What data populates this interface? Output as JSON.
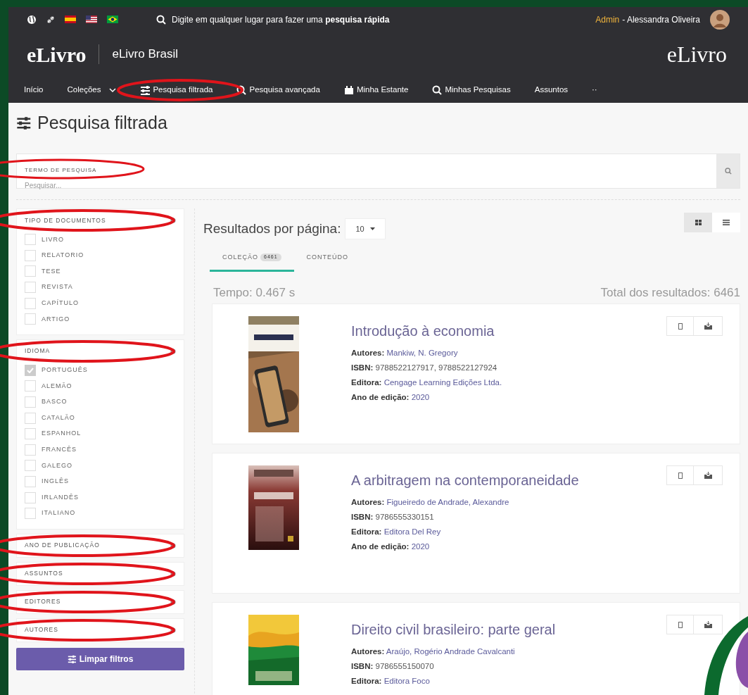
{
  "top_bar": {
    "search_hint": "Digite em qualquer lugar para fazer uma **pesquisa rápida**",
    "user_role": "Admin",
    "user_name": "- Alessandra Oliveira"
  },
  "brand": {
    "logo": "eLivro",
    "site_name": "eLivro Brasil",
    "right_logo": "eLivro"
  },
  "nav": [
    {
      "label": "Início",
      "kind": "plain",
      "highlighted": false
    },
    {
      "label": "Coleções",
      "kind": "dropdown",
      "highlighted": false
    },
    {
      "label": "Pesquisa filtrada",
      "kind": "filter",
      "highlighted": true
    },
    {
      "label": "Pesquisa avançada",
      "kind": "search",
      "highlighted": false
    },
    {
      "label": "Minha Estante",
      "kind": "shelf",
      "highlighted": false
    },
    {
      "label": "Minhas Pesquisas",
      "kind": "search",
      "highlighted": false
    },
    {
      "label": "Assuntos",
      "kind": "plain",
      "highlighted": false
    },
    {
      "label": "··",
      "kind": "plain",
      "highlighted": false
    }
  ],
  "page_title": "Pesquisa filtrada",
  "search": {
    "label": "TERMO DE PESQUISA",
    "placeholder": "Pesquisar...",
    "highlighted": true
  },
  "filters": [
    {
      "title": "TIPO DE DOCUMENTOS",
      "expanded": true,
      "highlighted": true,
      "options": [
        {
          "label": "LIVRO",
          "checked": false
        },
        {
          "label": "RELATORIO",
          "checked": false
        },
        {
          "label": "TESE",
          "checked": false
        },
        {
          "label": "REVISTA",
          "checked": false
        },
        {
          "label": "CAPÍTULO",
          "checked": false
        },
        {
          "label": "ARTIGO",
          "checked": false
        }
      ]
    },
    {
      "title": "IDIOMA",
      "expanded": true,
      "highlighted": true,
      "options": [
        {
          "label": "PORTUGUÊS",
          "checked": true
        },
        {
          "label": "ALEMÃO",
          "checked": false
        },
        {
          "label": "BASCO",
          "checked": false
        },
        {
          "label": "CATALÃO",
          "checked": false
        },
        {
          "label": "ESPANHOL",
          "checked": false
        },
        {
          "label": "FRANCÊS",
          "checked": false
        },
        {
          "label": "GALEGO",
          "checked": false
        },
        {
          "label": "INGLÊS",
          "checked": false
        },
        {
          "label": "IRLANDÊS",
          "checked": false
        },
        {
          "label": "ITALIANO",
          "checked": false
        }
      ]
    },
    {
      "title": "ANO DE PUBLICAÇÃO",
      "expanded": false,
      "highlighted": true
    },
    {
      "title": "ASSUNTOS",
      "expanded": false,
      "highlighted": true
    },
    {
      "title": "EDITORES",
      "expanded": false,
      "highlighted": true
    },
    {
      "title": "AUTORES",
      "expanded": false,
      "highlighted": true
    }
  ],
  "clear_button": "Limpar filtros",
  "results": {
    "per_page_label": "Resultados por página:",
    "per_page_value": "10",
    "views": [
      {
        "kind": "grid",
        "selected": true
      },
      {
        "kind": "list",
        "selected": false
      }
    ],
    "tabs": [
      {
        "label": "COLEÇÃO",
        "count": "6461",
        "selected": true
      },
      {
        "label": "CONTEÚDO",
        "selected": false
      }
    ],
    "time": "Tempo: 0.467 s",
    "total": "Total dos resultados: 6461",
    "books": [
      {
        "title": "Introdução à economia",
        "fields": [
          {
            "label": "Autores:",
            "value": "Mankiw, N. Gregory",
            "link": true
          },
          {
            "label": "ISBN:",
            "value": "9788522127917, 9788522127924",
            "link": false
          },
          {
            "label": "Editora:",
            "value": "Cengage Learning Edições Ltda.",
            "link": true
          },
          {
            "label": "Ano de edição:",
            "value": "2020",
            "link": true
          }
        ]
      },
      {
        "title": "A arbitragem na contemporaneidade",
        "fields": [
          {
            "label": "Autores:",
            "value": "Figueiredo de Andrade, Alexandre",
            "link": true
          },
          {
            "label": "ISBN:",
            "value": "9786555330151",
            "link": false
          },
          {
            "label": "Editora:",
            "value": "Editora Del Rey",
            "link": true
          },
          {
            "label": "Ano de edição:",
            "value": "2020",
            "link": true
          }
        ]
      },
      {
        "title": "Direito civil brasileiro: parte geral",
        "fields": [
          {
            "label": "Autores:",
            "value": "Araújo, Rogério Andrade Cavalcanti",
            "link": true
          },
          {
            "label": "ISBN:",
            "value": "9786555150070",
            "link": false
          },
          {
            "label": "Editora:",
            "value": "Editora Foco",
            "link": true
          }
        ]
      }
    ]
  }
}
